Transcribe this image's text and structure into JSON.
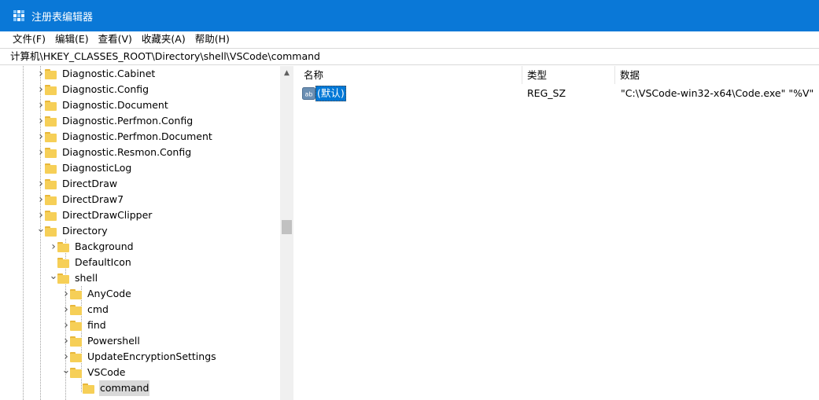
{
  "window": {
    "title": "注册表编辑器"
  },
  "menu": [
    "文件(F)",
    "编辑(E)",
    "查看(V)",
    "收藏夹(A)",
    "帮助(H)"
  ],
  "address": "计算机\\HKEY_CLASSES_ROOT\\Directory\\shell\\VSCode\\command",
  "tree": {
    "items": [
      {
        "label": "Diagnostic.Cabinet",
        "expander": "collapsed"
      },
      {
        "label": "Diagnostic.Config",
        "expander": "collapsed"
      },
      {
        "label": "Diagnostic.Document",
        "expander": "collapsed"
      },
      {
        "label": "Diagnostic.Perfmon.Config",
        "expander": "collapsed"
      },
      {
        "label": "Diagnostic.Perfmon.Document",
        "expander": "collapsed"
      },
      {
        "label": "Diagnostic.Resmon.Config",
        "expander": "collapsed"
      },
      {
        "label": "DiagnosticLog",
        "expander": "none"
      },
      {
        "label": "DirectDraw",
        "expander": "collapsed"
      },
      {
        "label": "DirectDraw7",
        "expander": "collapsed"
      },
      {
        "label": "DirectDrawClipper",
        "expander": "collapsed"
      },
      {
        "label": "Directory",
        "expander": "expanded"
      },
      {
        "label": "Background",
        "expander": "collapsed"
      },
      {
        "label": "DefaultIcon",
        "expander": "none"
      },
      {
        "label": "shell",
        "expander": "expanded"
      },
      {
        "label": "AnyCode",
        "expander": "collapsed"
      },
      {
        "label": "cmd",
        "expander": "collapsed"
      },
      {
        "label": "find",
        "expander": "collapsed"
      },
      {
        "label": "Powershell",
        "expander": "collapsed"
      },
      {
        "label": "UpdateEncryptionSettings",
        "expander": "collapsed"
      },
      {
        "label": "VSCode",
        "expander": "expanded"
      },
      {
        "label": "command",
        "expander": "none",
        "selected": true
      }
    ]
  },
  "columns": {
    "name": "名称",
    "type": "类型",
    "data": "数据"
  },
  "values": [
    {
      "name": "(默认)",
      "type": "REG_SZ",
      "data": "\"C:\\VSCode-win32-x64\\Code.exe\" \"%V\""
    }
  ],
  "colors": {
    "titlebar": "#0a78d7",
    "selection": "#0078d7",
    "folder": "#f6cf57"
  }
}
